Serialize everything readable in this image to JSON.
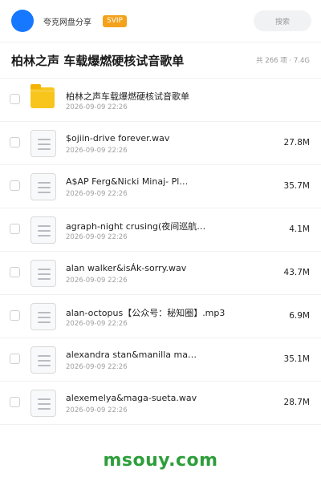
{
  "header": {
    "username": "夸克网盘分享",
    "badge": "SVIP",
    "search_label": "搜索"
  },
  "share": {
    "title": "柏林之声 车载爆燃硬核试音歌单",
    "meta": "共 266 项 · 7.4G"
  },
  "files": [
    {
      "type": "folder",
      "icon": "folder-icon",
      "name": "柏林之声车载爆燃硬核试音歌单",
      "date": "2026-09-09 22:26",
      "size": ""
    },
    {
      "type": "file",
      "icon": "document-icon",
      "name": "$ojiin-drive forever.wav",
      "date": "2026-09-09 22:26",
      "size": "27.8M"
    },
    {
      "type": "file",
      "icon": "document-icon",
      "name": "A$AP Ferg&Nicki Minaj- Pl…",
      "date": "2026-09-09 22:26",
      "size": "35.7M"
    },
    {
      "type": "file",
      "icon": "document-icon",
      "name": "agraph-night crusing(夜间巡航…",
      "date": "2026-09-09 22:26",
      "size": "4.1M"
    },
    {
      "type": "file",
      "icon": "document-icon",
      "name": "alan walker&isÁk-sorry.wav",
      "date": "2026-09-09 22:26",
      "size": "43.7M"
    },
    {
      "type": "file",
      "icon": "document-icon",
      "name": "alan-octopus【公众号：秘知圈】.mp3",
      "date": "2026-09-09 22:26",
      "size": "6.9M"
    },
    {
      "type": "file",
      "icon": "document-icon",
      "name": "alexandra stan&manilla ma…",
      "date": "2026-09-09 22:26",
      "size": "35.1M"
    },
    {
      "type": "file",
      "icon": "document-icon",
      "name": "alexemelya&maga-sueta.wav",
      "date": "2026-09-09 22:26",
      "size": "28.7M"
    }
  ],
  "watermark": "msouy.com",
  "colors": {
    "avatar": "#1677ff",
    "badge": "#f4a11b",
    "folder": "#f8c51c",
    "watermark": "#2e9e3b"
  }
}
